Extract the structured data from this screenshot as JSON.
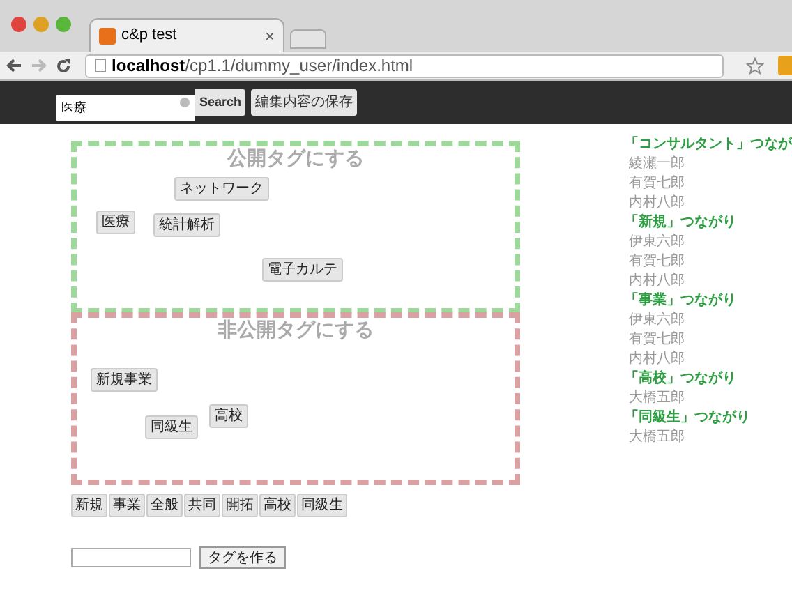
{
  "browser": {
    "tab_title": "c&p test",
    "tab_close": "×",
    "url_host": "localhost",
    "url_path": "/cp1.1/dummy_user/index.html"
  },
  "toolbar": {
    "search": {
      "value": "医療"
    },
    "search_button": "Search",
    "save_button": "編集内容の保存"
  },
  "zones": [
    {
      "kind": "public",
      "title": "公開タグにする",
      "tags": [
        "ネットワーク",
        "医療",
        "統計解析",
        "電子カルテ"
      ]
    },
    {
      "kind": "private",
      "title": "非公開タグにする",
      "tags": [
        "新規事業",
        "同級生",
        "高校"
      ]
    }
  ],
  "tag_pool": [
    "新規",
    "事業",
    "全般",
    "共同",
    "開拓",
    "高校",
    "同級生"
  ],
  "new_tag": {
    "button": "タグを作る"
  },
  "connections": [
    {
      "heading": "「コンサルタント」つなが",
      "people": [
        "綾瀬一郎",
        "有賀七郎",
        "内村八郎"
      ]
    },
    {
      "heading": "「新規」つながり",
      "people": [
        "伊東六郎",
        "有賀七郎",
        "内村八郎"
      ]
    },
    {
      "heading": "「事業」つながり",
      "people": [
        "伊東六郎",
        "有賀七郎",
        "内村八郎"
      ]
    },
    {
      "heading": "「高校」つながり",
      "people": [
        "大橋五郎"
      ]
    },
    {
      "heading": "「同級生」つながり",
      "people": [
        "大橋五郎"
      ]
    }
  ]
}
